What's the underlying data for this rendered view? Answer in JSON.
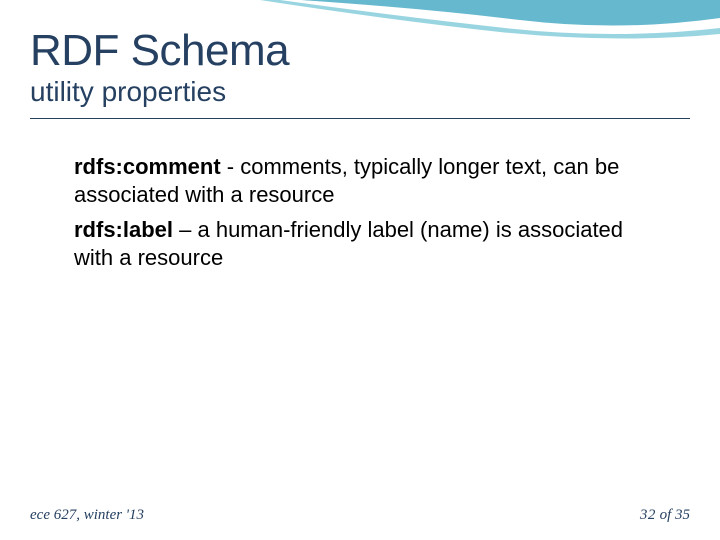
{
  "header": {
    "title": "RDF Schema",
    "subtitle": "utility properties"
  },
  "body": {
    "items": [
      {
        "term": "rdfs:comment",
        "desc": " - comments, typically longer text, can be associated with a resource"
      },
      {
        "term": "rdfs:label",
        "desc": " – a human-friendly label (name) is associated with a resource"
      }
    ]
  },
  "footer": {
    "left": "ece 627, winter '13",
    "page_current": "32",
    "page_sep": "  of ",
    "page_total": "35"
  }
}
